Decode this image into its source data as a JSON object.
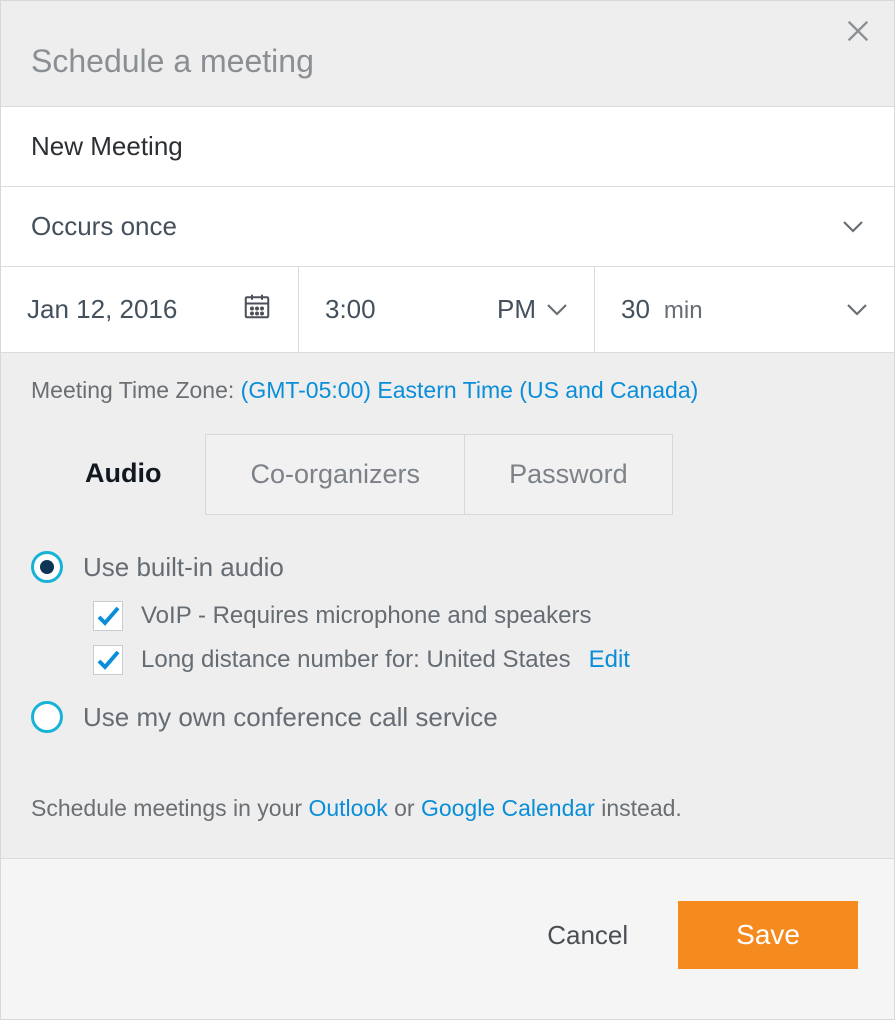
{
  "dialog": {
    "title": "Schedule a meeting",
    "meeting_name": "New Meeting",
    "occurrence": "Occurs once",
    "date": "Jan 12, 2016",
    "time": "3:00",
    "ampm": "PM",
    "duration_value": "30",
    "duration_unit": "min",
    "timezone_label": "Meeting Time Zone: ",
    "timezone_value": "(GMT-05:00) Eastern Time (US and Canada)"
  },
  "tabs": {
    "audio": "Audio",
    "coorganizers": "Co-organizers",
    "password": "Password"
  },
  "audio": {
    "builtin_label": "Use built-in audio",
    "voip_label": "VoIP - Requires microphone and speakers",
    "long_distance_prefix": "Long distance number for: ",
    "long_distance_country": "United States",
    "edit_link": "Edit",
    "own_service_label": "Use my own conference call service"
  },
  "instead": {
    "prefix": "Schedule meetings in your ",
    "outlook": "Outlook",
    "or": " or ",
    "gcal": "Google Calendar",
    "suffix": " instead."
  },
  "footer": {
    "cancel": "Cancel",
    "save": "Save"
  }
}
